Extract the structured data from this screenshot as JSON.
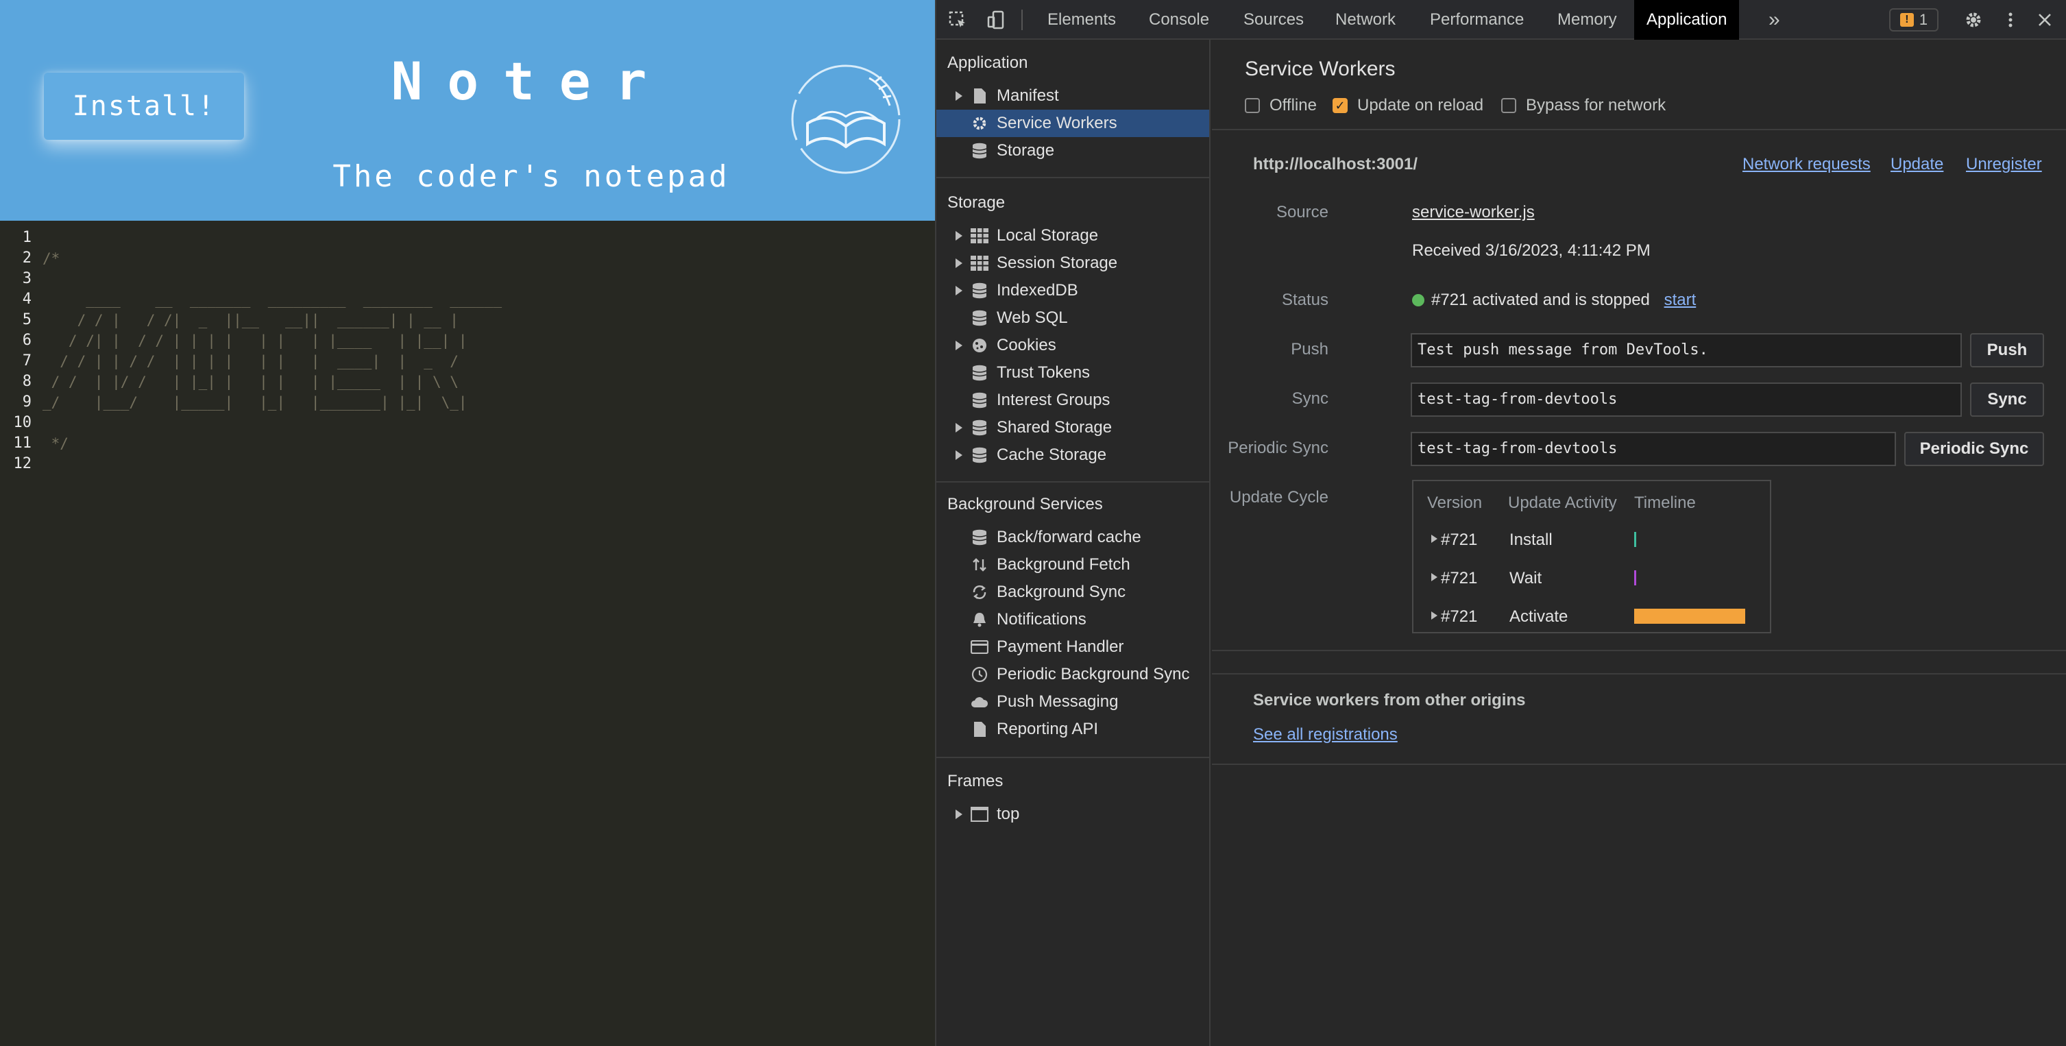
{
  "app": {
    "install_label": "Install!",
    "title": "Noter",
    "subtitle": "The coder's notepad",
    "line_numbers": [
      "1",
      "2",
      "3",
      "4",
      "5",
      "6",
      "7",
      "8",
      "9",
      "10",
      "11",
      "12"
    ],
    "code_lines": [
      "",
      "/*",
      "",
      "     ____    __  _______  _________  ________  ______",
      "    / / |   / /|  _  ||__   __||  ______| | __ |",
      "   / /| |  / / | | | |   | |   | |____   | |__| |",
      "  / / | | / /  | | | |   | |   |  ____|  |  _  /",
      " / /  | |/ /   | |_| |   | |   | |_____  | | \\ \\",
      "_/    |___/    |_____|   |_|   |_______| |_|  \\_|",
      "",
      " */",
      ""
    ]
  },
  "devtools": {
    "tabs": [
      "Elements",
      "Console",
      "Sources",
      "Network",
      "Performance",
      "Memory",
      "Application"
    ],
    "active_tab": "Application",
    "more_tabs": "»",
    "issues_count": "1",
    "sidebar": {
      "application_heading": "Application",
      "application_items": [
        {
          "label": "Manifest",
          "icon": "file-icon"
        },
        {
          "label": "Service Workers",
          "icon": "gear-icon"
        },
        {
          "label": "Storage",
          "icon": "database-icon"
        }
      ],
      "storage_heading": "Storage",
      "storage_items": [
        {
          "label": "Local Storage",
          "icon": "grid-icon"
        },
        {
          "label": "Session Storage",
          "icon": "grid-icon"
        },
        {
          "label": "IndexedDB",
          "icon": "database-icon"
        },
        {
          "label": "Web SQL",
          "icon": "database-icon"
        },
        {
          "label": "Cookies",
          "icon": "cookie-icon"
        },
        {
          "label": "Trust Tokens",
          "icon": "database-icon"
        },
        {
          "label": "Interest Groups",
          "icon": "database-icon"
        },
        {
          "label": "Shared Storage",
          "icon": "database-icon"
        },
        {
          "label": "Cache Storage",
          "icon": "database-icon"
        }
      ],
      "background_heading": "Background Services",
      "background_items": [
        {
          "label": "Back/forward cache",
          "icon": "database-icon"
        },
        {
          "label": "Background Fetch",
          "icon": "swap-icon"
        },
        {
          "label": "Background Sync",
          "icon": "sync-icon"
        },
        {
          "label": "Notifications",
          "icon": "bell-icon"
        },
        {
          "label": "Payment Handler",
          "icon": "card-icon"
        },
        {
          "label": "Periodic Background Sync",
          "icon": "clock-icon"
        },
        {
          "label": "Push Messaging",
          "icon": "cloud-icon"
        },
        {
          "label": "Reporting API",
          "icon": "file-icon"
        }
      ],
      "frames_heading": "Frames",
      "frames_items": [
        {
          "label": "top",
          "icon": "window-icon"
        }
      ]
    },
    "service_workers": {
      "title": "Service Workers",
      "offline_label": "Offline",
      "offline_checked": false,
      "update_on_reload_label": "Update on reload",
      "update_on_reload_checked": true,
      "bypass_label": "Bypass for network",
      "bypass_checked": false,
      "origin": "http://localhost:3001/",
      "network_requests_link": "Network requests",
      "update_link": "Update",
      "unregister_link": "Unregister",
      "source_label": "Source",
      "source_file": "service-worker.js",
      "received": "Received 3/16/2023, 4:11:42 PM",
      "status_label": "Status",
      "status_text": "#721 activated and is stopped",
      "status_color": "#5cb85c",
      "start_link": "start",
      "push_label": "Push",
      "push_value": "Test push message from DevTools.",
      "push_button": "Push",
      "sync_label": "Sync",
      "sync_value": "test-tag-from-devtools",
      "sync_button": "Sync",
      "periodic_label": "Periodic Sync",
      "periodic_value": "test-tag-from-devtools",
      "periodic_button": "Periodic Sync",
      "update_cycle_label": "Update Cycle",
      "cycle_headers": [
        "Version",
        "Update Activity",
        "Timeline"
      ],
      "cycle_rows": [
        {
          "version": "#721",
          "activity": "Install"
        },
        {
          "version": "#721",
          "activity": "Wait"
        },
        {
          "version": "#721",
          "activity": "Activate"
        }
      ],
      "other_origins_title": "Service workers from other origins",
      "see_all_link": "See all registrations"
    },
    "accent_color": "#f3a33c",
    "link_color": "#8ab4f8"
  }
}
